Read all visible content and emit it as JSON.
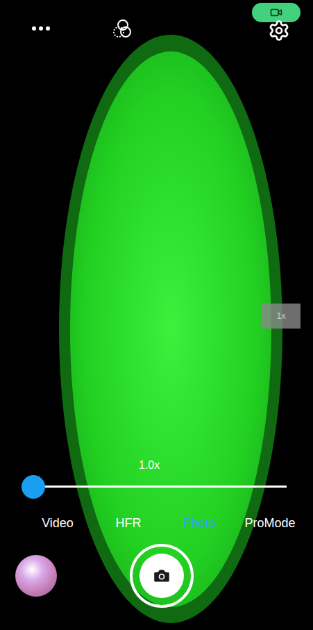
{
  "lens_button": {
    "label": "1x"
  },
  "zoom": {
    "label": "1.0x",
    "level": 0.0
  },
  "modes": [
    {
      "label": "Video",
      "selected": false
    },
    {
      "label": "HFR",
      "selected": false
    },
    {
      "label": "Photo",
      "selected": true
    },
    {
      "label": "ProMode",
      "selected": false
    }
  ]
}
